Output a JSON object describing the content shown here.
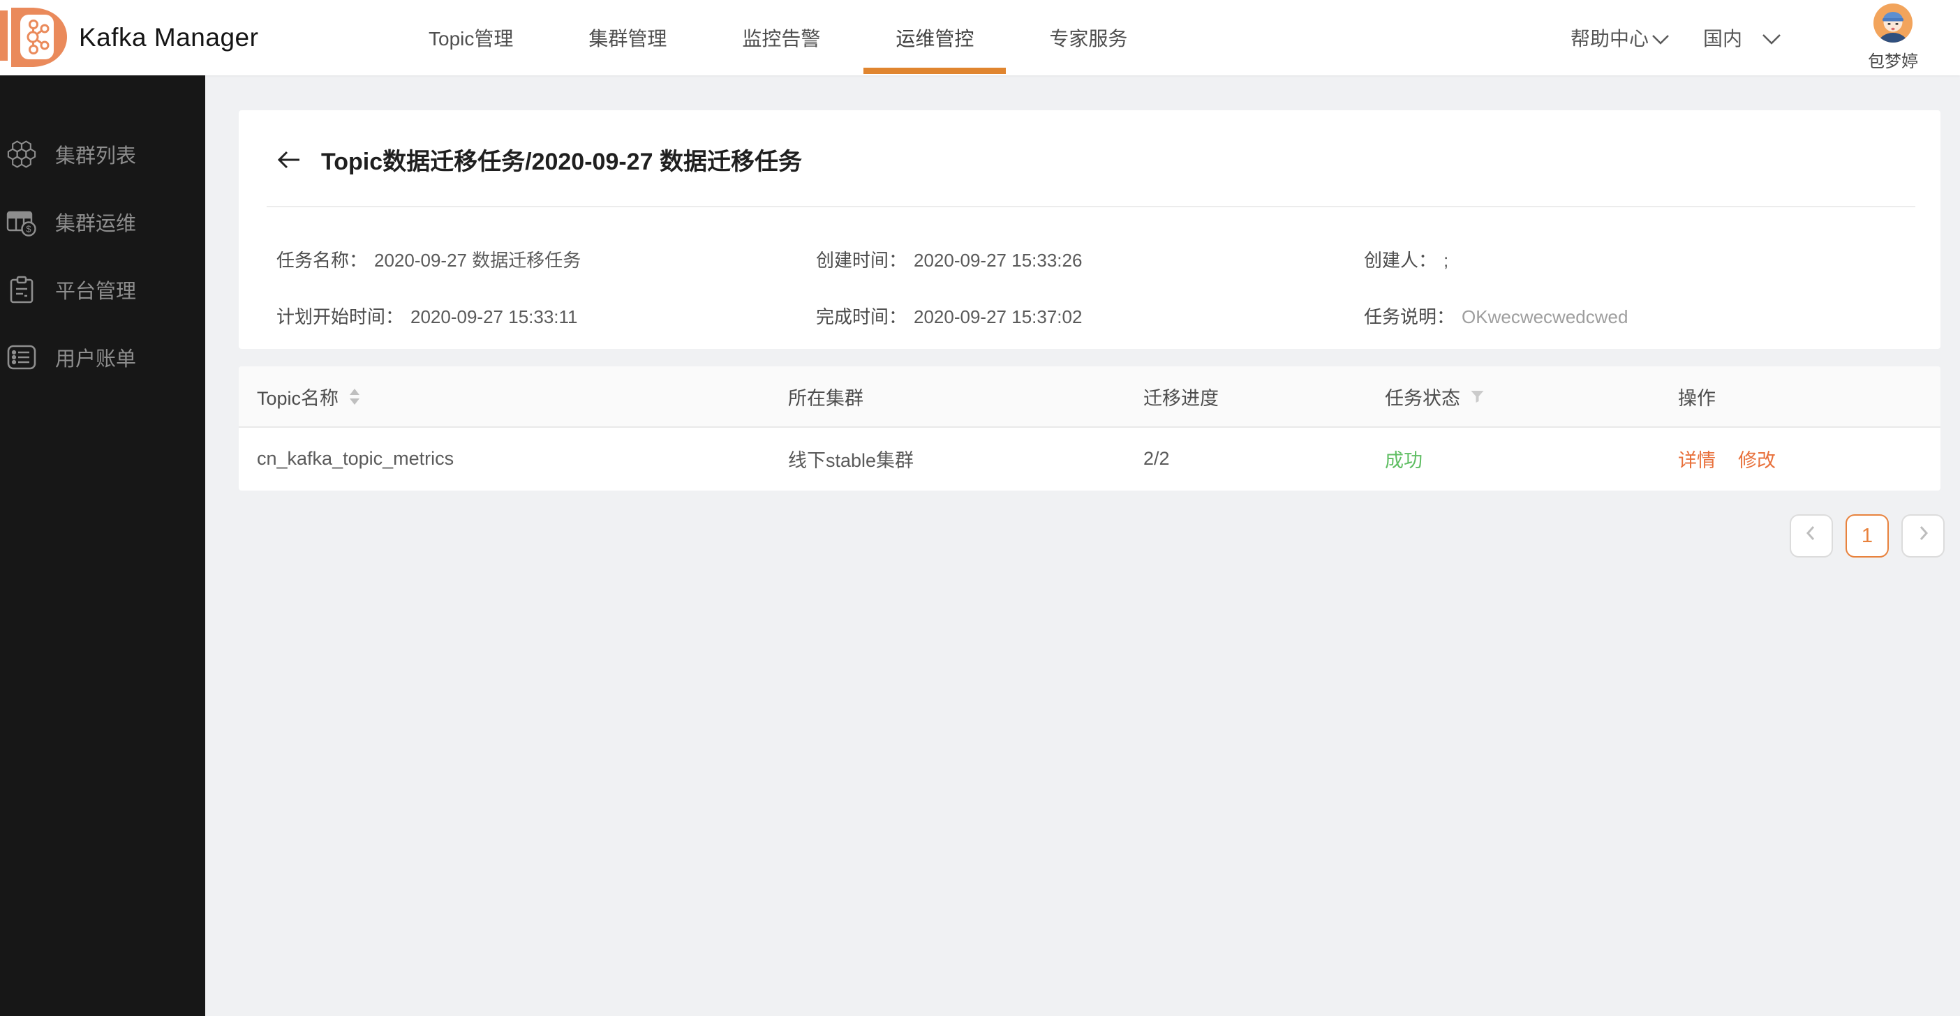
{
  "colors": {
    "accent_orange": "#E8823D",
    "logo_orange": "#EA8A5B",
    "underline_orange": "#E0852F",
    "success_green": "#5FBE63",
    "link_orange": "#E8713C",
    "sidebar_bg": "#171717"
  },
  "header": {
    "brand": "Kafka Manager",
    "nav": [
      {
        "label": "Topic管理",
        "active": false
      },
      {
        "label": "集群管理",
        "active": false
      },
      {
        "label": "监控告警",
        "active": false
      },
      {
        "label": "运维管控",
        "active": true
      },
      {
        "label": "专家服务",
        "active": false
      }
    ],
    "help_label": "帮助中心",
    "region_label": "国内",
    "username": "包梦婷"
  },
  "sidebar": {
    "items": [
      {
        "icon": "honeycomb-cluster-icon",
        "label": "集群列表"
      },
      {
        "icon": "grid-coin-icon",
        "label": "集群运维"
      },
      {
        "icon": "clipboard-icon",
        "label": "平台管理"
      },
      {
        "icon": "list-bill-icon",
        "label": "用户账单"
      }
    ]
  },
  "page": {
    "title": "Topic数据迁移任务/2020-09-27 数据迁移任务",
    "details": [
      {
        "label": "任务名称：",
        "value": "2020-09-27 数据迁移任务"
      },
      {
        "label": "创建时间：",
        "value": "2020-09-27 15:33:26"
      },
      {
        "label": "创建人：",
        "value": ";"
      },
      {
        "label": "计划开始时间：",
        "value": "2020-09-27 15:33:11"
      },
      {
        "label": "完成时间：",
        "value": "2020-09-27 15:37:02"
      },
      {
        "label": "任务说明：",
        "value": "OKwecwecwedcwed"
      }
    ]
  },
  "table": {
    "columns": [
      "Topic名称",
      "所在集群",
      "迁移进度",
      "任务状态",
      "操作"
    ],
    "rows": [
      {
        "topic": "cn_kafka_topic_metrics",
        "cluster": "线下stable集群",
        "progress": "2/2",
        "status": "成功",
        "actions": [
          "详情",
          "修改"
        ]
      }
    ]
  },
  "pagination": {
    "current": "1"
  }
}
